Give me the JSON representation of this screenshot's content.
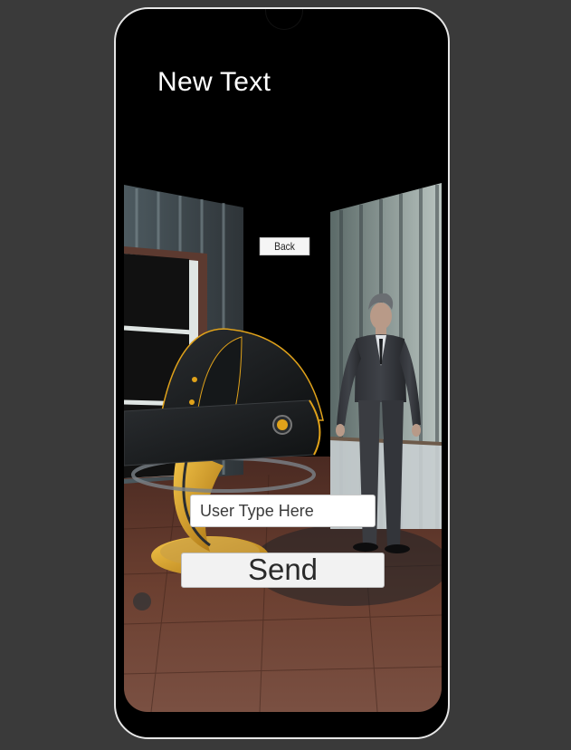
{
  "screen": {
    "title": "New Text"
  },
  "scene": {
    "objects": [
      "room-walls",
      "window",
      "office-chair",
      "businessman-avatar",
      "wooden-floor"
    ]
  },
  "controls": {
    "back_label": "Back",
    "input_placeholder": "User Type Here",
    "input_value": "",
    "send_label": "Send"
  },
  "colors": {
    "background": "#3a3a3a",
    "frame": "#e6e6e6",
    "chair_accent": "#e0a21a",
    "floor": "#6a3d2c"
  }
}
